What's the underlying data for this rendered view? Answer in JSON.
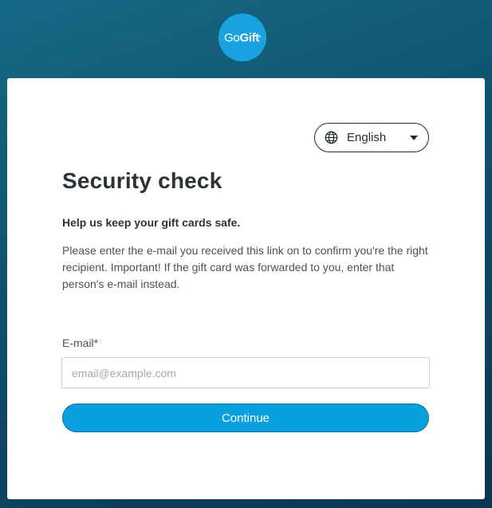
{
  "logo": {
    "text_regular": "Go",
    "text_bold": "Gift",
    "mark": "•"
  },
  "language": {
    "icon": "globe-icon",
    "selected": "English"
  },
  "page": {
    "title": "Security check",
    "subtitle": "Help us keep your gift cards safe.",
    "description": "Please enter the e-mail you received this link on to confirm you're the right recipient. Important! If the gift card was forwarded to you, enter that person's e-mail instead."
  },
  "form": {
    "email_label": "E-mail*",
    "email_value": "",
    "email_placeholder": "email@example.com",
    "submit_label": "Continue"
  },
  "colors": {
    "background_top": "#166a85",
    "background_bottom": "#0b3550",
    "brand": "#1aa3e0",
    "button": "#0aa0df",
    "text": "#2b3338"
  }
}
